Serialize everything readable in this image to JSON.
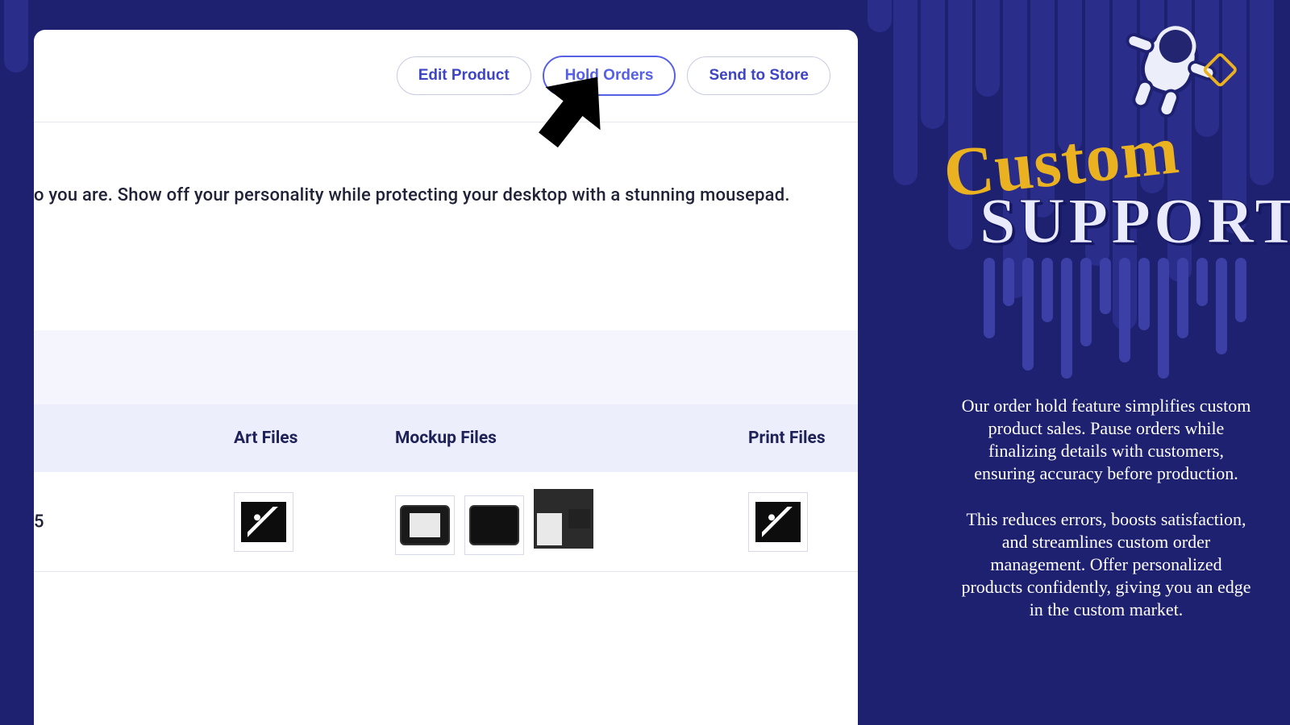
{
  "toolbar": {
    "buttons": [
      {
        "label": "Edit Product",
        "active": false
      },
      {
        "label": "Hold Orders",
        "active": true
      },
      {
        "label": "Send to Store",
        "active": false
      }
    ]
  },
  "description_fragment": "o you are. Show off your personality while protecting your desktop with a stunning mousepad.",
  "columns": {
    "art": "Art Files",
    "mockup": "Mockup Files",
    "print": "Print Files"
  },
  "row": {
    "number_fragment": "5"
  },
  "sidebar": {
    "title_top": "Custom",
    "title_bottom": "SUPPORT",
    "para1": "Our order hold feature simplifies custom product sales. Pause orders while finalizing details with customers, ensuring accuracy before production.",
    "para2": "This reduces errors, boosts satisfaction, and streamlines custom order management. Offer personalized products confidently, giving you an edge in the custom market."
  }
}
